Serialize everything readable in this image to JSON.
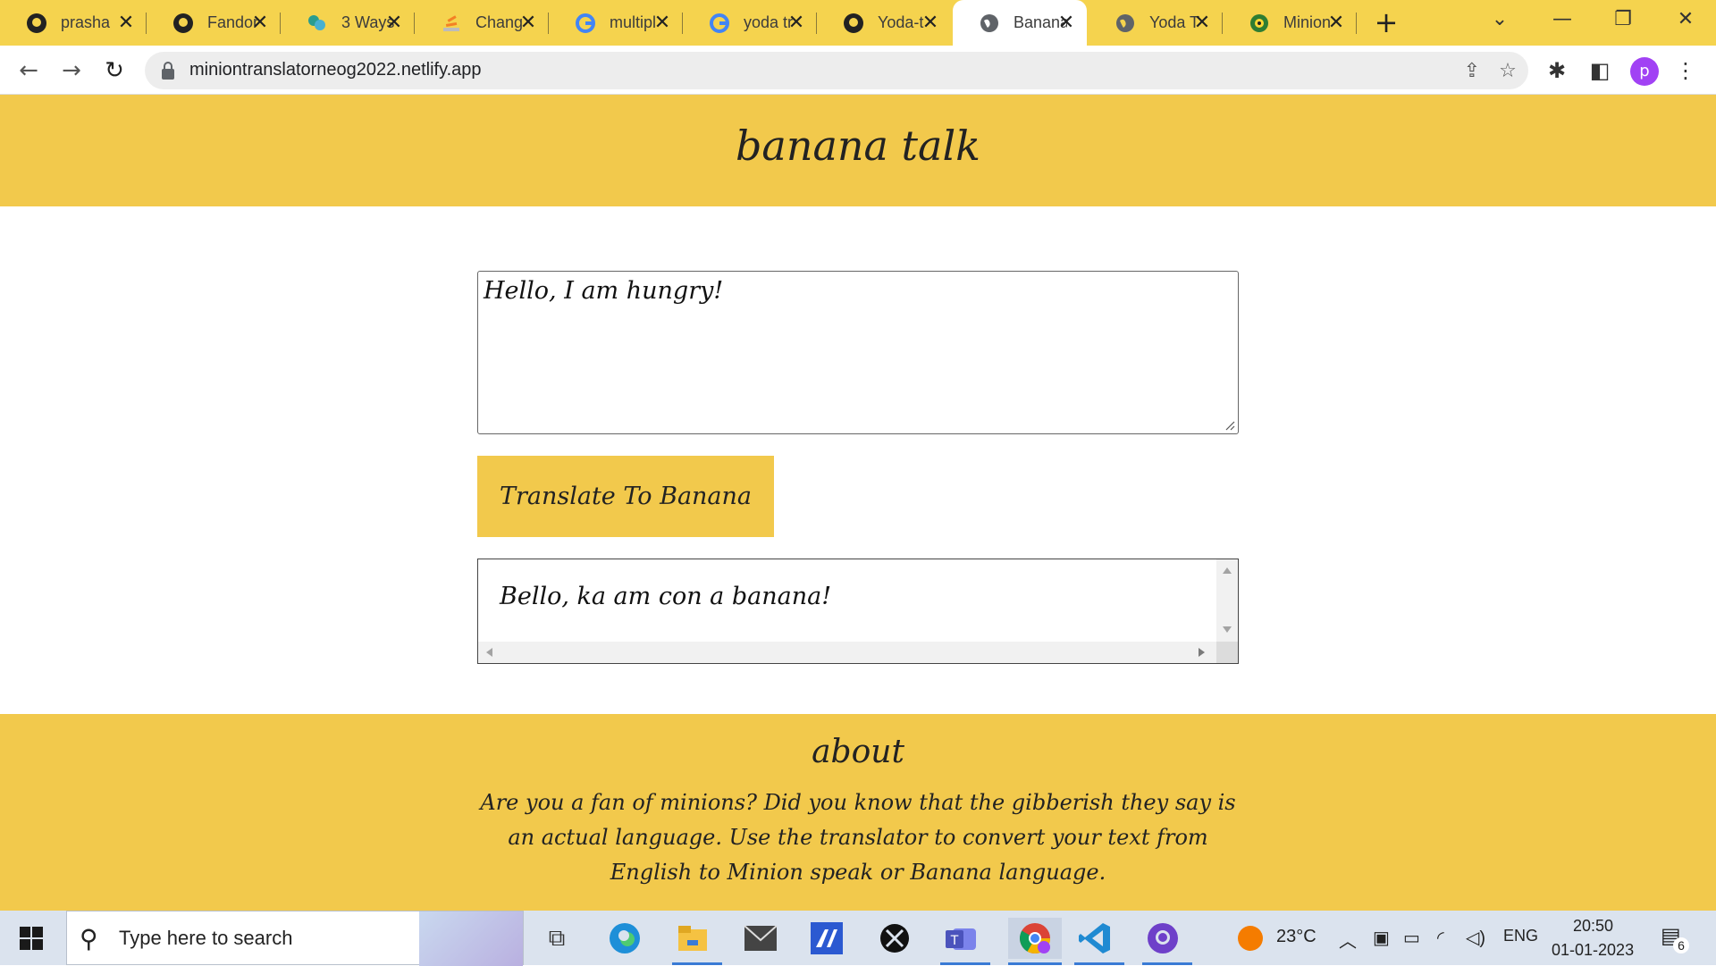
{
  "browser": {
    "tabs": [
      {
        "label": "prasha",
        "icon": "github-icon"
      },
      {
        "label": "Fandor",
        "icon": "github-icon"
      },
      {
        "label": "3 Ways",
        "icon": "leaf-icon"
      },
      {
        "label": "Chang",
        "icon": "stack-icon"
      },
      {
        "label": "multipl",
        "icon": "google-icon"
      },
      {
        "label": "yoda tr",
        "icon": "google-icon"
      },
      {
        "label": "Yoda-t",
        "icon": "github-icon"
      },
      {
        "label": "Banana",
        "icon": "globe-icon"
      },
      {
        "label": "Yoda T",
        "icon": "globe-icon"
      },
      {
        "label": "Minion",
        "icon": "minion-icon"
      }
    ],
    "active_tab": 7,
    "new_tab_label": "+",
    "url": "miniontranslatorneog2022.netlify.app",
    "profile_initial": "p"
  },
  "page": {
    "title": "banana talk",
    "input_text": "Hello, I am hungry!",
    "button_label": "Translate To Banana",
    "output_text": "Bello, ka am con a banana!",
    "about_heading": "about",
    "about_text": "Are you a fan of minions? Did you know that the gibberish they say is an actual language. Use the translator to convert your text from English to Minion speak or Banana language."
  },
  "taskbar": {
    "search_placeholder": "Type here to search",
    "temperature": "23°C",
    "language": "ENG",
    "time": "20:50",
    "date": "01-01-2023",
    "notification_count": "6"
  },
  "colors": {
    "tabbar": "#f5d34e",
    "page_accent": "#f2c94c"
  }
}
